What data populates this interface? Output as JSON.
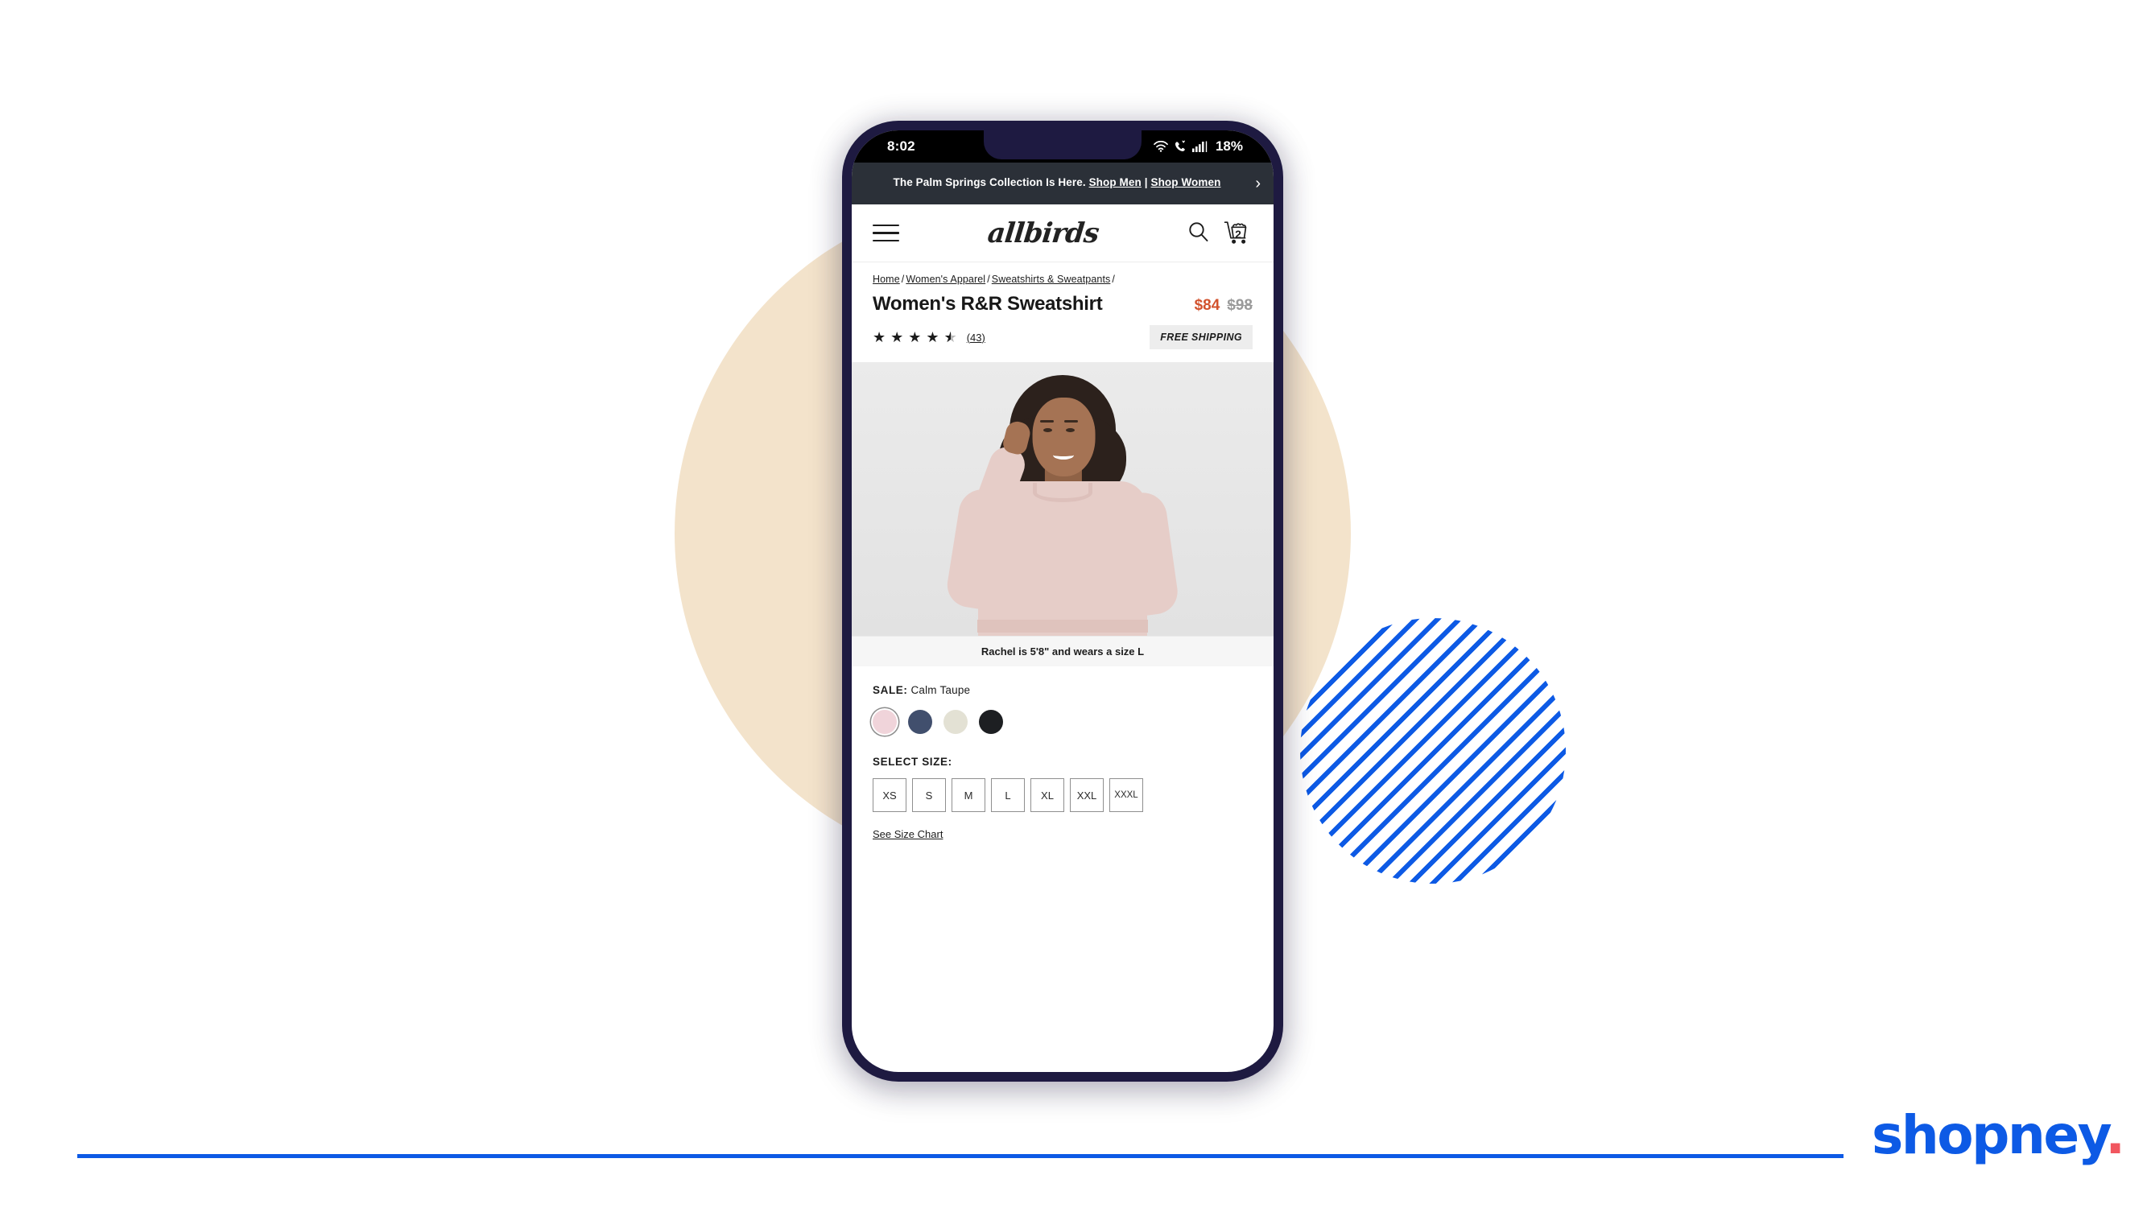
{
  "phone": {
    "status_bar": {
      "time": "8:02",
      "battery": "18%",
      "icons": [
        "wifi-icon",
        "call-icon",
        "signal-icon"
      ]
    }
  },
  "announcement": {
    "text_before": "The Palm Springs Collection Is Here.",
    "link_men": "Shop Men",
    "separator": "|",
    "link_women": "Shop Women",
    "arrow": "›"
  },
  "header": {
    "menu_icon": "hamburger-icon",
    "brand": "allbirds",
    "search_icon": "search-icon",
    "cart_icon": "cart-icon",
    "cart_count": "2"
  },
  "breadcrumb": [
    {
      "label": "Home"
    },
    {
      "label": "Women's Apparel"
    },
    {
      "label": "Sweatshirts & Sweatpants"
    }
  ],
  "product": {
    "title": "Women's R&R Sweatshirt",
    "price_sale": "$84",
    "price_compare": "$98",
    "rating": 4.5,
    "stars_full": 4,
    "stars_half": 1,
    "review_count": "(43)",
    "shipping_badge": "FREE SHIPPING",
    "hero_caption": "Rachel is 5'8\" and wears a size L"
  },
  "variants": {
    "color_label": "SALE:",
    "color_value": "Calm Taupe",
    "swatches": [
      {
        "name": "Calm Taupe",
        "hex": "#f0d4da",
        "selected": true
      },
      {
        "name": "Navy",
        "hex": "#414f6d",
        "selected": false
      },
      {
        "name": "Natural White",
        "hex": "#e3e1d4",
        "selected": false
      },
      {
        "name": "Black",
        "hex": "#1d1f22",
        "selected": false
      }
    ],
    "size_label": "SELECT SIZE:",
    "sizes": [
      "XS",
      "S",
      "M",
      "L",
      "XL",
      "XXL",
      "XXXL"
    ],
    "size_chart_link": "See Size Chart"
  },
  "branding": {
    "logo_text": "shopney",
    "logo_dot": ".",
    "blue": "#0d5ae5",
    "dot_color": "#f1565f",
    "beige": "#f3e3cb",
    "bezel": "#1e1a41"
  }
}
